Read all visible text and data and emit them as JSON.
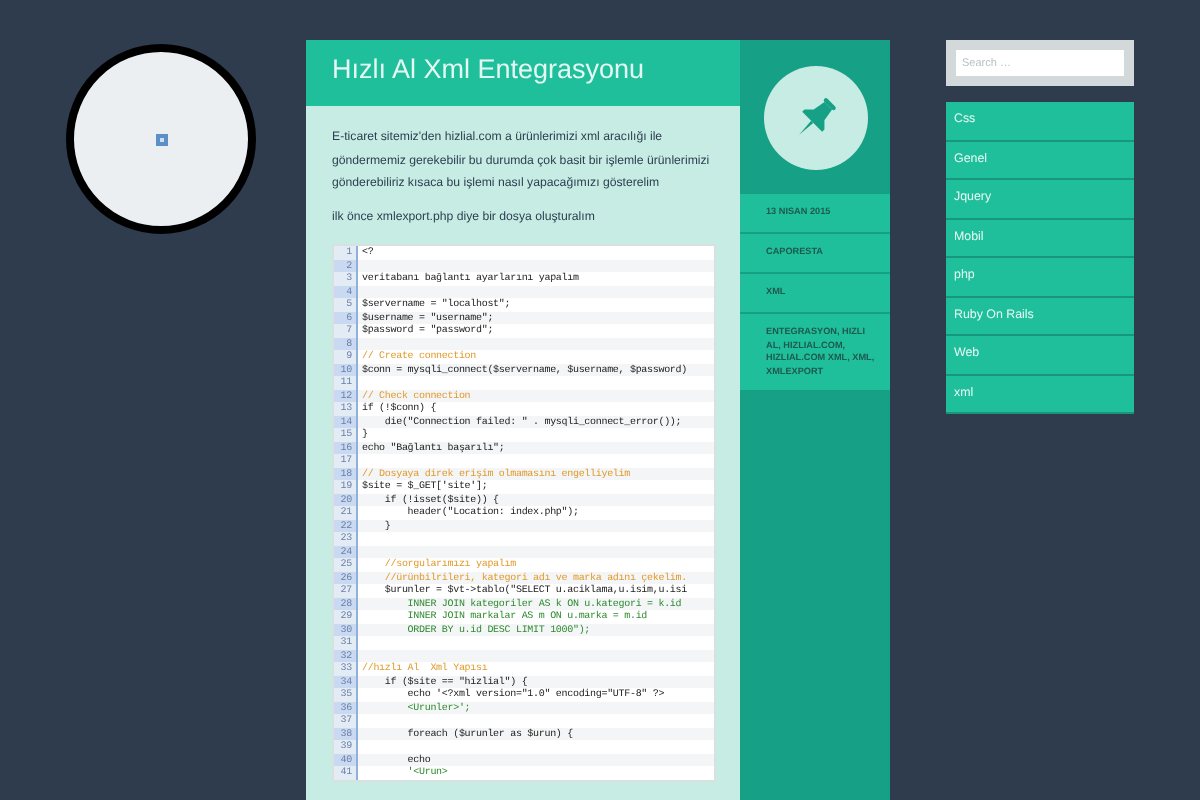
{
  "avatar": {
    "broken_image": true
  },
  "post": {
    "title": "Hızlı Al Xml Entegrasyonu",
    "paragraphs": [
      "E-ticaret sitemiz'den hizlial.com a ürünlerimizi xml aracılığı ile göndermemiz gerekebilir bu durumda çok basit bir işlemle ürünlerimizi gönderebiliriz kısaca bu işlemi nasıl yapacağımızı gösterelim",
      "ilk önce xmlexport.php diye bir dosya oluşturalım"
    ],
    "code": [
      {
        "number": "1",
        "kind": "code",
        "text": "<?"
      },
      {
        "number": "2",
        "kind": "code"
      },
      {
        "number": "3",
        "kind": "code",
        "text": "veritabanı bağlantı ayarlarını yapalım"
      },
      {
        "number": "4",
        "kind": "code"
      },
      {
        "number": "5",
        "kind": "code",
        "text": "$servername = \"localhost\";"
      },
      {
        "number": "6",
        "kind": "code",
        "text": "$username = \"username\";"
      },
      {
        "number": "7",
        "kind": "code",
        "text": "$password = \"password\";"
      },
      {
        "number": "8",
        "kind": "code"
      },
      {
        "number": "9",
        "kind": "comment",
        "text": "// Create connection"
      },
      {
        "number": "10",
        "kind": "code",
        "text": "$conn = mysqli_connect($servername, $username, $password)"
      },
      {
        "number": "11",
        "kind": "code"
      },
      {
        "number": "12",
        "kind": "comment",
        "text": "// Check connection"
      },
      {
        "number": "13",
        "kind": "code",
        "text": "if (!$conn) {"
      },
      {
        "number": "14",
        "kind": "code",
        "text": "    die(\"Connection failed: \" . mysqli_connect_error());"
      },
      {
        "number": "15",
        "kind": "code",
        "text": "}"
      },
      {
        "number": "16",
        "kind": "code",
        "text": "echo \"Bağlantı başarılı\";"
      },
      {
        "number": "17",
        "kind": "code"
      },
      {
        "number": "18",
        "kind": "comment",
        "text": "// Dosyaya direk erişim olmamasını engelliyelim"
      },
      {
        "number": "19",
        "kind": "code",
        "text": "$site = $_GET['site'];"
      },
      {
        "number": "20",
        "kind": "code",
        "text": "    if (!isset($site)) {"
      },
      {
        "number": "21",
        "kind": "code",
        "text": "        header(\"Location: index.php\");"
      },
      {
        "number": "22",
        "kind": "code",
        "text": "    }"
      },
      {
        "number": "23",
        "kind": "code"
      },
      {
        "number": "24",
        "kind": "code"
      },
      {
        "number": "25",
        "kind": "comment",
        "text": "    //sorgularımızı yapalım"
      },
      {
        "number": "26",
        "kind": "comment",
        "text": "    //ürünbilrileri, kategori adı ve marka adını çekelim."
      },
      {
        "number": "27",
        "kind": "code",
        "text": "    $urunler = $vt->tablo(\"SELECT u.aciklama,u.isim,u.isi"
      },
      {
        "number": "28",
        "kind": "string",
        "text": "        INNER JOIN kategoriler AS k ON u.kategori = k.id"
      },
      {
        "number": "29",
        "kind": "string",
        "text": "        INNER JOIN markalar AS m ON u.marka = m.id"
      },
      {
        "number": "30",
        "kind": "string",
        "text": "        ORDER BY u.id DESC LIMIT 1000\");"
      },
      {
        "number": "31",
        "kind": "code"
      },
      {
        "number": "32",
        "kind": "code"
      },
      {
        "number": "33",
        "kind": "comment",
        "text": "//hızlı Al  Xml Yapısı"
      },
      {
        "number": "34",
        "kind": "code",
        "text": "    if ($site == \"hizlial\") {"
      },
      {
        "number": "35",
        "kind": "code",
        "text": "        echo '<?xml version=\"1.0\" encoding=\"UTF-8\" ?>"
      },
      {
        "number": "36",
        "kind": "string",
        "text": "        <Urunler>';"
      },
      {
        "number": "37",
        "kind": "code"
      },
      {
        "number": "38",
        "kind": "code",
        "text": "        foreach ($urunler as $urun) {"
      },
      {
        "number": "39",
        "kind": "code"
      },
      {
        "number": "40",
        "kind": "code",
        "text": "        echo"
      },
      {
        "number": "41",
        "kind": "string",
        "text": "        '<Urun>"
      }
    ]
  },
  "meta": [
    "13 NISAN 2015",
    "CAPORESTA",
    "XML",
    "ENTEGRASYON, HIZLI AL, HIZLIAL.COM, HIZLIAL.COM XML, XML, XMLEXPORT"
  ],
  "search": {
    "placeholder": "Search …"
  },
  "categories": [
    "Css",
    "Genel",
    "Jquery",
    "Mobil",
    "php",
    "Ruby On Rails",
    "Web",
    "xml"
  ]
}
